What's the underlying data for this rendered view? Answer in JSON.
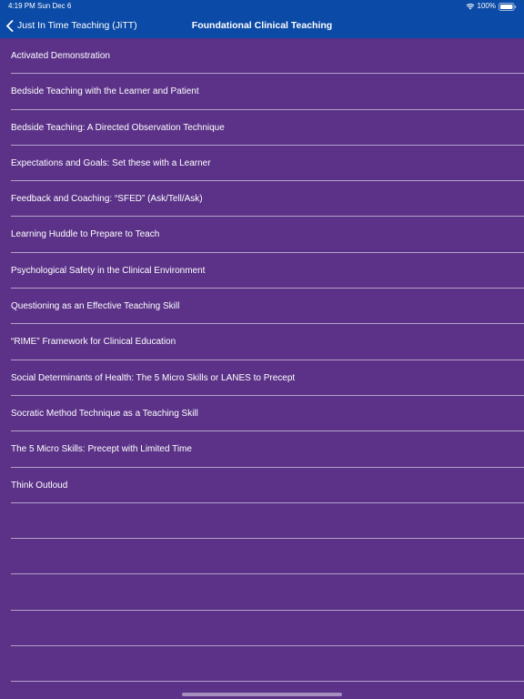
{
  "status_bar": {
    "time": "4:19 PM",
    "date": "Sun Dec 6",
    "battery": "100%"
  },
  "nav": {
    "back_label": "Just In Time Teaching (JiTT)",
    "title": "Foundational Clinical Teaching"
  },
  "colors": {
    "nav_background": "#0b4aa6",
    "list_background": "#5b3288",
    "text": "#ffffff"
  },
  "icons": {
    "back": "chevron-left-icon",
    "wifi": "wifi-icon",
    "battery": "battery-icon"
  },
  "list_items": [
    "Activated Demonstration",
    "Bedside Teaching with the Learner and Patient",
    "Bedside Teaching: A Directed Observation Technique",
    "Expectations and Goals: Set these with a Learner",
    "Feedback and Coaching: “SFED” (Ask/Tell/Ask)",
    "Learning Huddle to Prepare to Teach",
    "Psychological Safety in the Clinical Environment",
    "Questioning as an Effective Teaching Skill",
    "“RIME” Framework for Clinical Education",
    "Social Determinants of Health: The 5 Micro Skills or LANES to Precept",
    "Socratic Method Technique as a Teaching Skill",
    "The 5 Micro Skills: Precept with Limited Time",
    "Think Outloud",
    "",
    "",
    "",
    "",
    "",
    ""
  ]
}
